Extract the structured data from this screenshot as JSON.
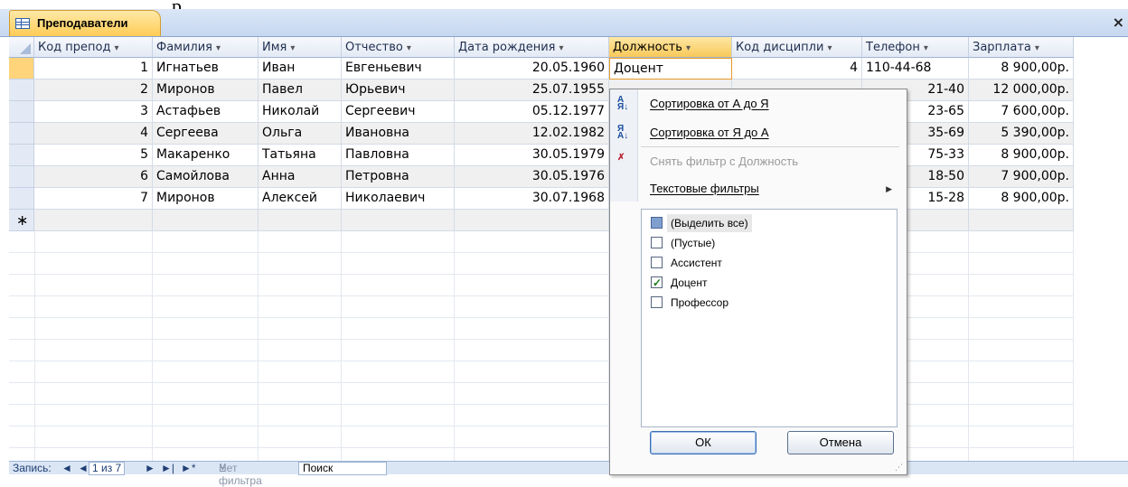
{
  "title_fragment": "р",
  "tab": {
    "title": "Преподаватели",
    "close": "×"
  },
  "columns": [
    "Код препод",
    "Фамилия",
    "Имя",
    "Отчество",
    "Дата рождения",
    "Должность",
    "Код дисципли",
    "Телефон",
    "Зарплата"
  ],
  "rows": [
    {
      "id": "1",
      "last": "Игнатьев",
      "first": "Иван",
      "middle": "Евгеньевич",
      "dob": "20.05.1960",
      "pos": "Доцент",
      "disc": "4",
      "phone": "110-44-68",
      "salary": "8 900,00р."
    },
    {
      "id": "2",
      "last": "Миронов",
      "first": "Павел",
      "middle": "Юрьевич",
      "dob": "25.07.1955",
      "pos": "",
      "disc": "",
      "phone": "21-40",
      "salary": "12 000,00р."
    },
    {
      "id": "3",
      "last": "Астафьев",
      "first": "Николай",
      "middle": "Сергеевич",
      "dob": "05.12.1977",
      "pos": "",
      "disc": "",
      "phone": "23-65",
      "salary": "7 600,00р."
    },
    {
      "id": "4",
      "last": "Сергеева",
      "first": "Ольга",
      "middle": "Ивановна",
      "dob": "12.02.1982",
      "pos": "",
      "disc": "",
      "phone": "35-69",
      "salary": "5 390,00р."
    },
    {
      "id": "5",
      "last": "Макаренко",
      "first": "Татьяна",
      "middle": "Павловна",
      "dob": "30.05.1979",
      "pos": "",
      "disc": "",
      "phone": "75-33",
      "salary": "8 900,00р."
    },
    {
      "id": "6",
      "last": "Самойлова",
      "first": "Анна",
      "middle": "Петровна",
      "dob": "30.05.1976",
      "pos": "",
      "disc": "",
      "phone": "18-50",
      "salary": "7 900,00р."
    },
    {
      "id": "7",
      "last": "Миронов",
      "first": "Алексей",
      "middle": "Николаевич",
      "dob": "30.07.1968",
      "pos": "",
      "disc": "",
      "phone": "15-28",
      "salary": "8 900,00р."
    }
  ],
  "new_row_marker": "∗",
  "filter_menu": {
    "sort_asc": "Сортировка от А до Я",
    "sort_desc": "Сортировка от Я до А",
    "clear_filter": "Снять фильтр с Должность",
    "text_filters": "Текстовые фильтры",
    "options": [
      {
        "label": "(Выделить все)",
        "state": "indeterminate"
      },
      {
        "label": "(Пустые)",
        "state": "off"
      },
      {
        "label": "Ассистент",
        "state": "off"
      },
      {
        "label": "Доцент",
        "state": "on"
      },
      {
        "label": "Профессор",
        "state": "off"
      }
    ],
    "ok": "ОК",
    "cancel": "Отмена"
  },
  "status_bar": {
    "record_label": "Запись:",
    "first": "◄",
    "prev": "◄",
    "position": "1 из 7",
    "next": "►",
    "last": "►|",
    "new": "►*",
    "no_filter": "Нет фильтра",
    "search": "Поиск"
  }
}
